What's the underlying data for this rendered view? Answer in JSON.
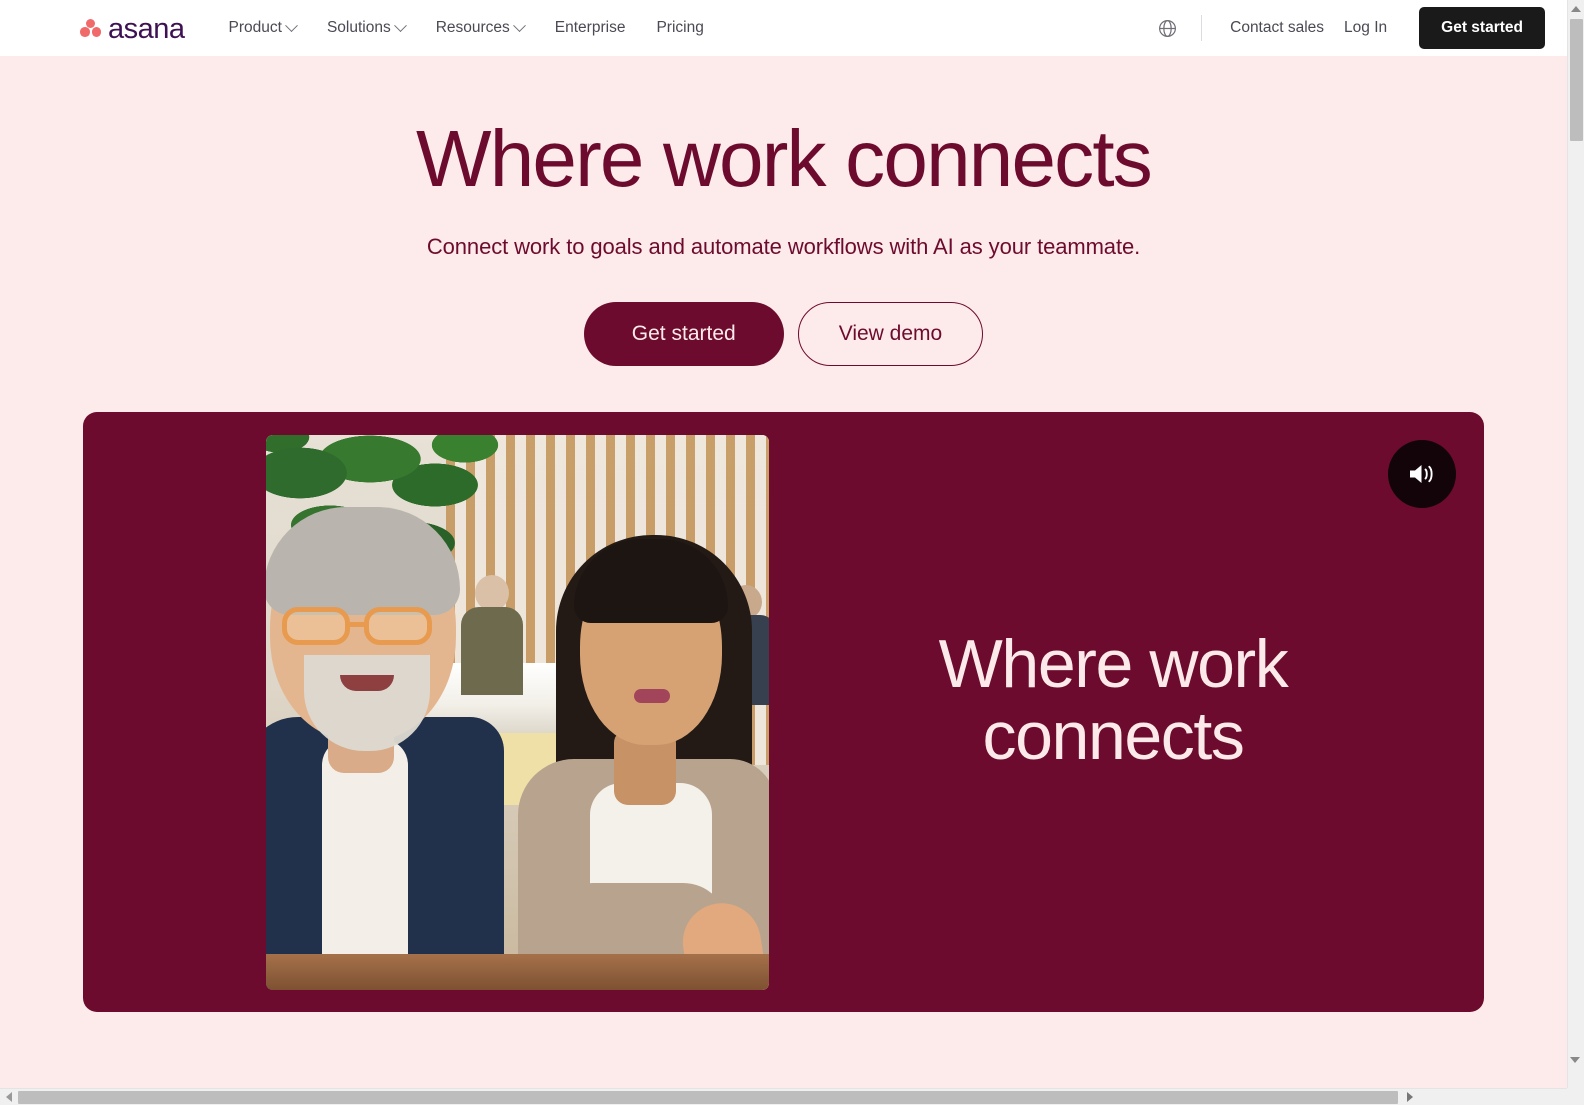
{
  "header": {
    "logo_text": "asana",
    "logo_icon": "asana-logo-dots",
    "nav_items": [
      {
        "label": "Product",
        "has_dropdown": true
      },
      {
        "label": "Solutions",
        "has_dropdown": true
      },
      {
        "label": "Resources",
        "has_dropdown": true
      },
      {
        "label": "Enterprise",
        "has_dropdown": false
      },
      {
        "label": "Pricing",
        "has_dropdown": false
      }
    ],
    "language_icon": "globe-icon",
    "contact_sales_label": "Contact sales",
    "login_label": "Log In",
    "get_started_label": "Get started"
  },
  "hero": {
    "headline": "Where work connects",
    "subheadline": "Connect work to goals and automate workflows with AI as your teammate.",
    "primary_cta": "Get started",
    "secondary_cta": "View demo"
  },
  "video_card": {
    "caption_line1": "Where work",
    "caption_line2": "connects",
    "sound_icon": "volume-on-icon"
  },
  "colors": {
    "page_background": "#fdeaea",
    "brand_maroon": "#6d0b2e",
    "logo_coral": "#f06a6a",
    "logo_wordmark": "#3d1152",
    "header_cta_background": "#1a1a1a",
    "caption_text": "#fce9ea",
    "nav_text": "#4a4a54"
  },
  "scrollbars": {
    "vertical_arrow_up": "scroll-up-arrow",
    "vertical_arrow_down": "scroll-down-arrow",
    "horizontal_arrow_left": "scroll-left-arrow",
    "horizontal_arrow_right": "scroll-right-arrow"
  }
}
